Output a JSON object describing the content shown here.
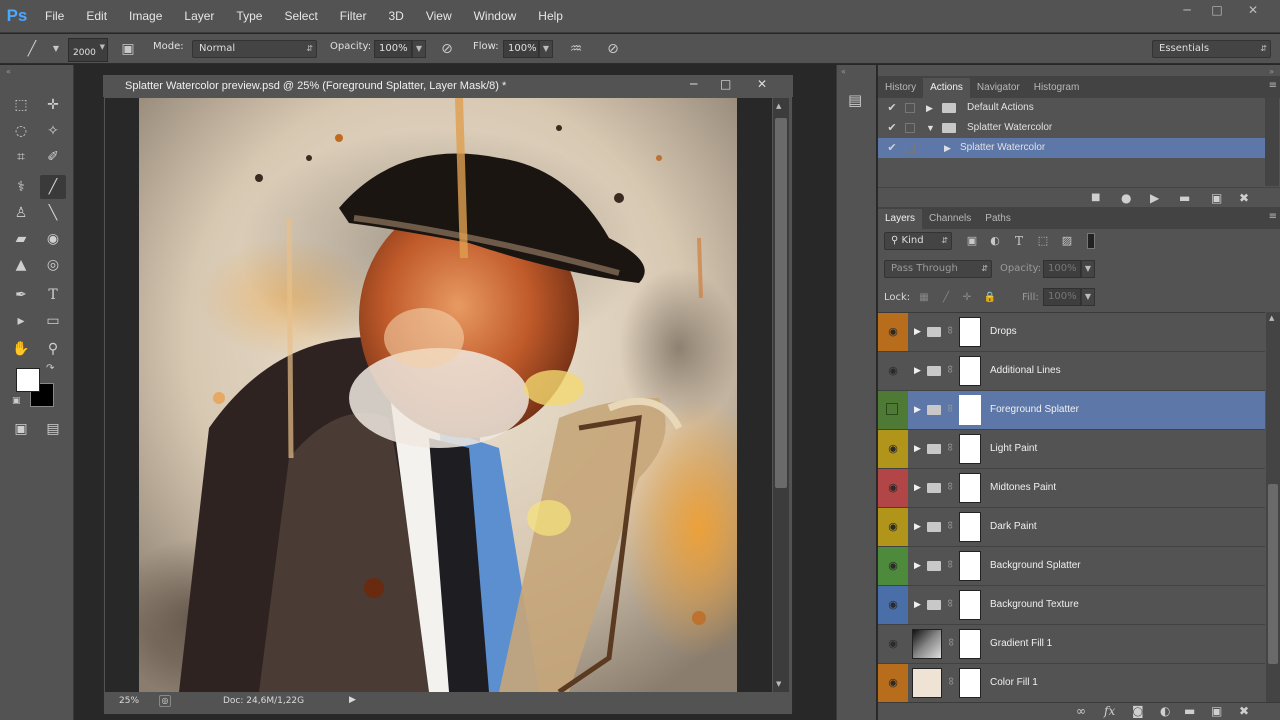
{
  "app": {
    "logo": "Ps"
  },
  "menu": [
    "File",
    "Edit",
    "Image",
    "Layer",
    "Type",
    "Select",
    "Filter",
    "3D",
    "View",
    "Window",
    "Help"
  ],
  "window_controls": {
    "minimize": "─",
    "maximize": "□",
    "close": "✕"
  },
  "options": {
    "brush_size": "2000",
    "mode_label": "Mode:",
    "mode_value": "Normal",
    "opacity_label": "Opacity:",
    "opacity_value": "100%",
    "flow_label": "Flow:",
    "flow_value": "100%",
    "workspace": "Essentials"
  },
  "document": {
    "title": "Splatter Watercolor preview.psd @ 25% (Foreground Splatter, Layer Mask/8) *",
    "zoom": "25%",
    "doc_info": "Doc: 24,6M/1,22G"
  },
  "actions_panel": {
    "tabs": [
      "History",
      "Actions",
      "Navigator",
      "Histogram"
    ],
    "active_tab": "Actions",
    "rows": [
      {
        "label": "Default Actions",
        "checked": true,
        "expanded": false,
        "type": "set"
      },
      {
        "label": "Splatter Watercolor",
        "checked": true,
        "expanded": true,
        "type": "set"
      },
      {
        "label": "Splatter Watercolor",
        "checked": true,
        "expanded": false,
        "type": "action"
      }
    ]
  },
  "layers_panel": {
    "tabs": [
      "Layers",
      "Channels",
      "Paths"
    ],
    "active_tab": "Layers",
    "filter_kind": "Kind",
    "blend_mode": "Pass Through",
    "opacity_label": "Opacity:",
    "opacity_value": "100%",
    "lock_label": "Lock:",
    "fill_label": "Fill:",
    "fill_value": "100%",
    "layers": [
      {
        "name": "Drops",
        "color": "#b86d1c",
        "visible": true,
        "type": "group"
      },
      {
        "name": "Additional Lines",
        "color": "#535353",
        "visible": true,
        "type": "group"
      },
      {
        "name": "Foreground Splatter",
        "color": "#4e7a35",
        "visible": false,
        "type": "group"
      },
      {
        "name": "Light Paint",
        "color": "#b0951a",
        "visible": true,
        "type": "group"
      },
      {
        "name": "Midtones Paint",
        "color": "#b24646",
        "visible": true,
        "type": "group"
      },
      {
        "name": "Dark Paint",
        "color": "#b0951a",
        "visible": true,
        "type": "group"
      },
      {
        "name": "Background Splatter",
        "color": "#4e8a3c",
        "visible": true,
        "type": "group"
      },
      {
        "name": "Background Texture",
        "color": "#4a6fa8",
        "visible": true,
        "type": "group"
      },
      {
        "name": "Gradient Fill 1",
        "color": "#535353",
        "visible": true,
        "type": "fill"
      },
      {
        "name": "Color Fill 1",
        "color": "#b86d1c",
        "visible": true,
        "type": "fill"
      }
    ]
  },
  "colors": {
    "accent_selection": "#5d77a8",
    "foreground_color": "#ffffff",
    "background_color": "#000000"
  }
}
